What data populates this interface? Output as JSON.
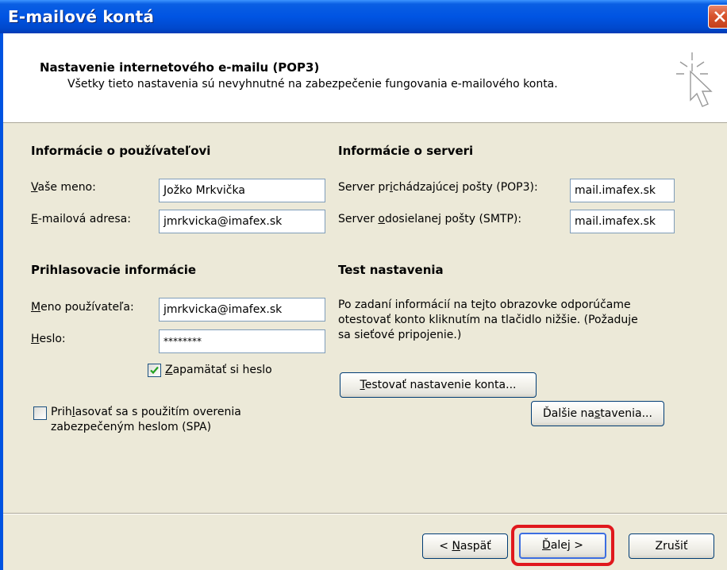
{
  "window": {
    "title": "E-mailové kontá"
  },
  "header": {
    "title": "Nastavenie internetového e-mailu (POP3)",
    "description": "Všetky tieto nastavenia sú nevyhnutné na zabezpečenie fungovania e-mailového konta."
  },
  "user_info": {
    "heading": "Informácie o používateľovi",
    "name_label_u": "V",
    "name_label_rest": "aše meno:",
    "name_value": "Jožko Mrkvička",
    "email_label_u": "E",
    "email_label_rest": "-mailová adresa:",
    "email_value": "jmrkvicka@imafex.sk"
  },
  "server_info": {
    "heading": "Informácie o serveri",
    "incoming_label_pre": "Server pr",
    "incoming_label_u": "i",
    "incoming_label_post": "chádzajúcej pošty (POP3):",
    "incoming_value": "mail.imafex.sk",
    "outgoing_label_pre": "Server ",
    "outgoing_label_u": "o",
    "outgoing_label_post": "dosielanej pošty (SMTP):",
    "outgoing_value": "mail.imafex.sk"
  },
  "login_info": {
    "heading": "Prihlasovacie informácie",
    "username_label_u": "M",
    "username_label_rest": "eno používateľa:",
    "username_value": "jmrkvicka@imafex.sk",
    "password_label_u": "H",
    "password_label_rest": "eslo:",
    "password_value": "********",
    "remember_label_u": "Z",
    "remember_label_rest": "apamätať si heslo",
    "remember_checked": true,
    "spa_label_line1_pre": "Prih",
    "spa_label_line1_u": "l",
    "spa_label_line1_post": "asovať sa s použitím overenia",
    "spa_label_line2": "zabezpečeným heslom (SPA)",
    "spa_checked": false
  },
  "test_settings": {
    "heading": "Test nastavenia",
    "text_line1": "Po zadaní informácií na tejto obrazovke odporúčame",
    "text_line2": "otestovať konto kliknutím na tlačidlo nižšie. (Požaduje",
    "text_line3": "sa sieťové pripojenie.)",
    "test_button_u": "T",
    "test_button_rest": "estovať nastavenie konta...",
    "more_button_pre": "Ďalšie na",
    "more_button_u": "s",
    "more_button_post": "tavenia..."
  },
  "footer": {
    "back_pre": "< ",
    "back_u": "N",
    "back_post": "aspäť",
    "next_u": "Ď",
    "next_post": "alej >",
    "cancel": "Zrušiť"
  },
  "colors": {
    "highlight": "#e0181d",
    "title_bar": "#0054e3"
  }
}
